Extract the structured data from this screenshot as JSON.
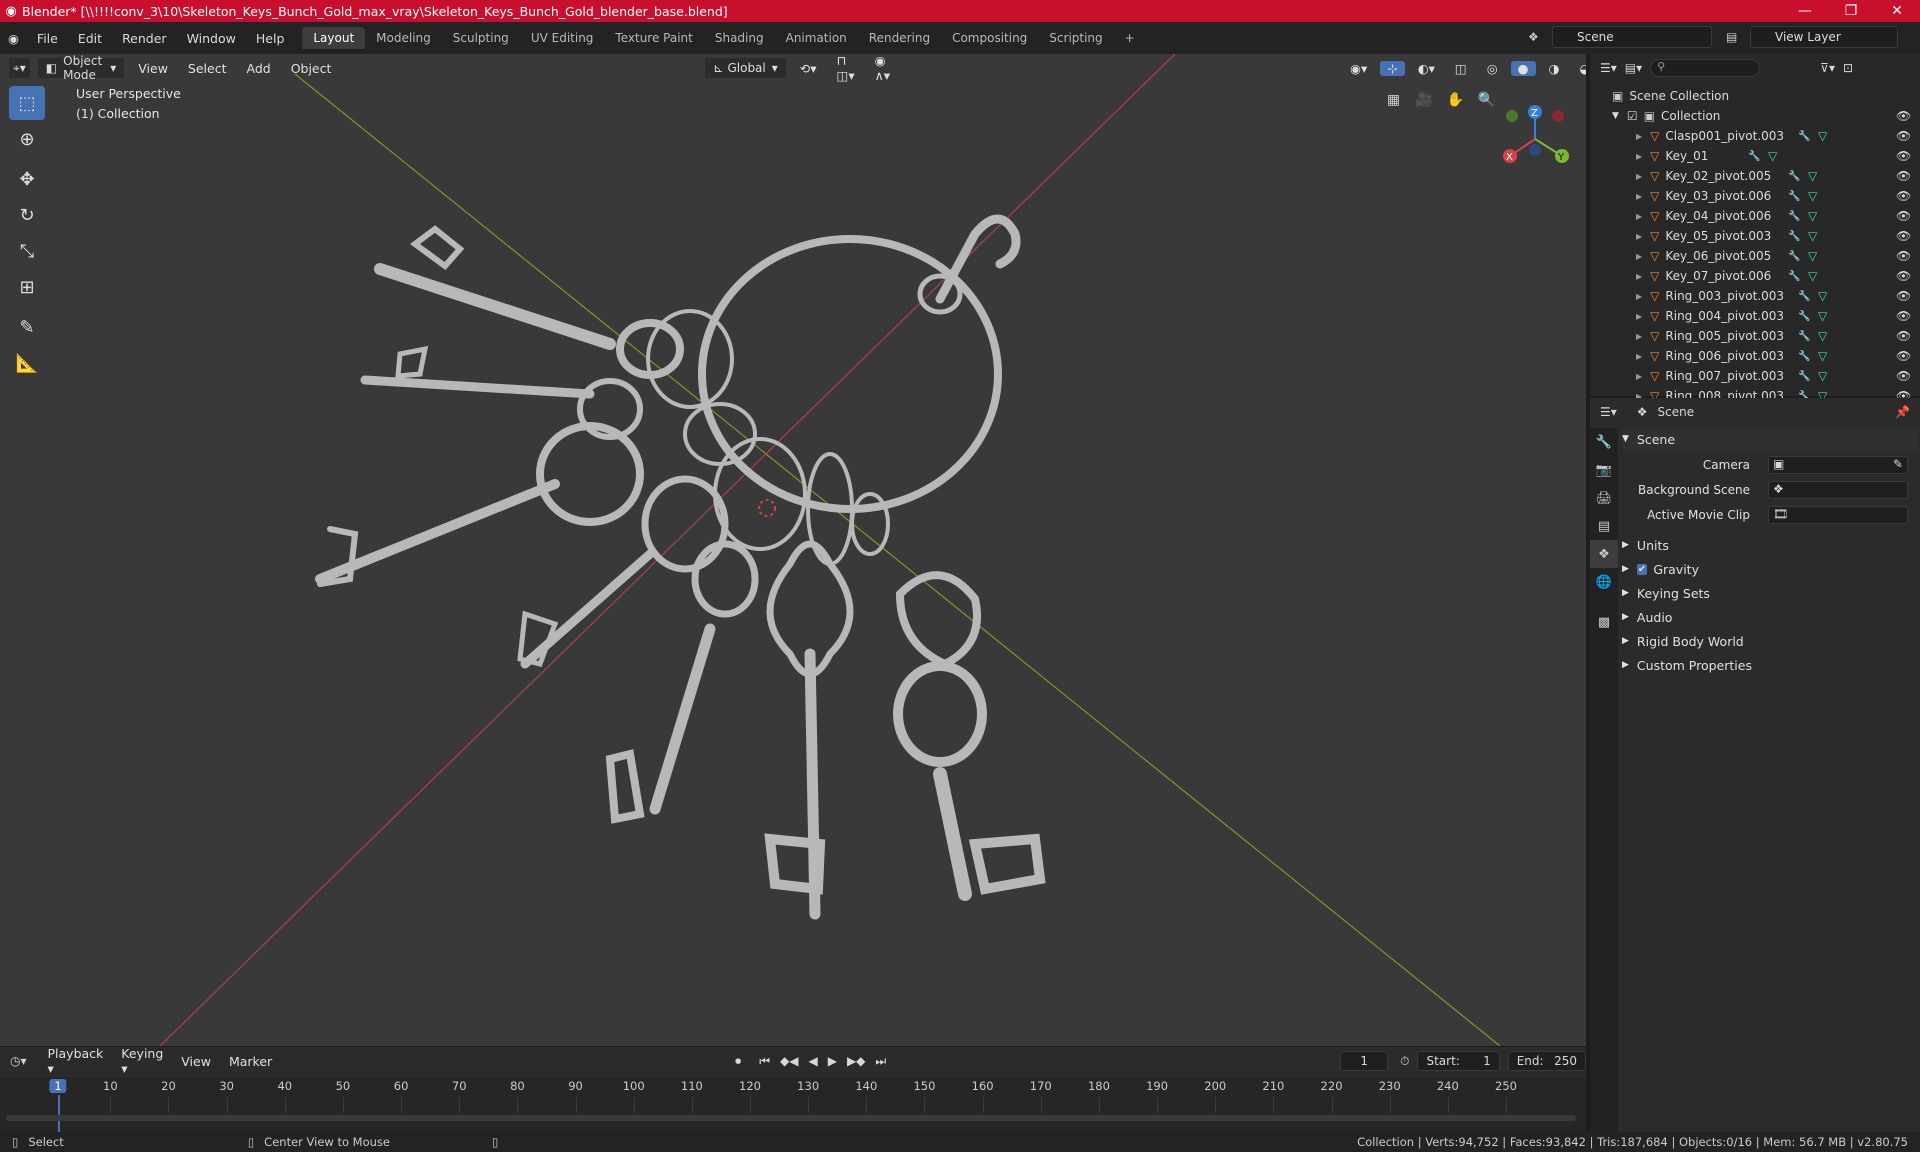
{
  "titlebar": {
    "title": "Blender* [\\\\!!!!conv_3\\10\\Skeleton_Keys_Bunch_Gold_max_vray\\Skeleton_Keys_Bunch_Gold_blender_base.blend]"
  },
  "menu": [
    "File",
    "Edit",
    "Render",
    "Window",
    "Help"
  ],
  "workspaces": [
    "Layout",
    "Modeling",
    "Sculpting",
    "UV Editing",
    "Texture Paint",
    "Shading",
    "Animation",
    "Rendering",
    "Compositing",
    "Scripting"
  ],
  "scene_name": "Scene",
  "view_layer": "View Layer",
  "viewport": {
    "mode": "Object Mode",
    "menus": [
      "View",
      "Select",
      "Add",
      "Object"
    ],
    "transform_orientation": "Global",
    "info_line1": "User Perspective",
    "info_line2": "(1) Collection",
    "gizmo": {
      "x": "X",
      "y": "Y",
      "z": "Z"
    }
  },
  "outliner": {
    "root": "Scene Collection",
    "collection": "Collection",
    "items": [
      "Clasp001_pivot.003",
      "Key_01",
      "Key_02_pivot.005",
      "Key_03_pivot.006",
      "Key_04_pivot.006",
      "Key_05_pivot.003",
      "Key_06_pivot.005",
      "Key_07_pivot.006",
      "Ring_003_pivot.003",
      "Ring_004_pivot.003",
      "Ring_005_pivot.003",
      "Ring_006_pivot.003",
      "Ring_007_pivot.003",
      "Ring_008_pivot.003"
    ]
  },
  "properties": {
    "context": "Scene",
    "section": "Scene",
    "camera_label": "Camera",
    "bg_scene_label": "Background Scene",
    "movie_clip_label": "Active Movie Clip",
    "panels": [
      "Units",
      "Gravity",
      "Keying Sets",
      "Audio",
      "Rigid Body World",
      "Custom Properties"
    ],
    "gravity_checked": true
  },
  "timeline": {
    "menus": [
      "Playback",
      "Keying",
      "View",
      "Marker"
    ],
    "current_frame": "1",
    "start_label": "Start:",
    "start": "1",
    "end_label": "End:",
    "end": "250",
    "ticks": [
      "1",
      "10",
      "20",
      "30",
      "40",
      "50",
      "60",
      "70",
      "80",
      "90",
      "100",
      "110",
      "120",
      "130",
      "140",
      "150",
      "160",
      "170",
      "180",
      "190",
      "200",
      "210",
      "220",
      "230",
      "240",
      "250"
    ]
  },
  "status": {
    "left": "Select",
    "mid": "Center View to Mouse",
    "right": "Collection | Verts:94,752 | Faces:93,842 | Tris:187,684 | Objects:0/16 | Mem: 56.7 MB | v2.80.75"
  },
  "colors": {
    "title_bar": "#c8102e",
    "accent": "#4772b3",
    "object_icon": "#e8883a",
    "modifier_icon": "#6aa0e8",
    "mesh_icon": "#3dd6b8"
  }
}
